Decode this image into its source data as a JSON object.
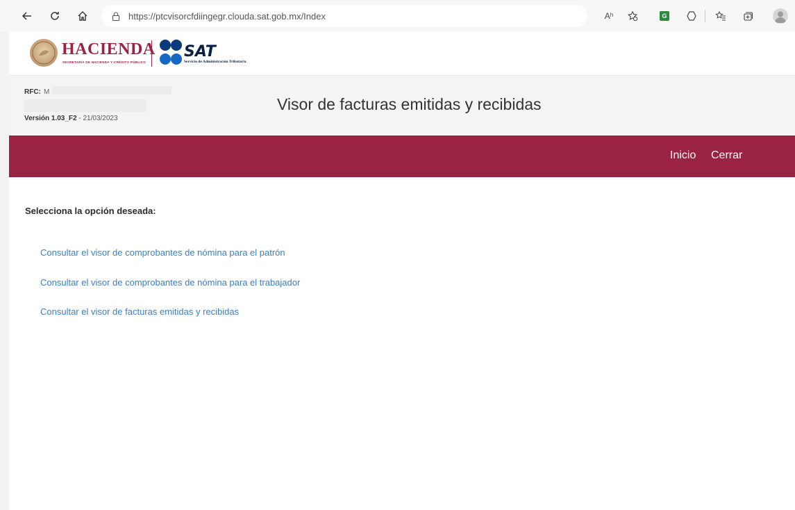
{
  "browser": {
    "url": "https://ptcvisorcfdiingegr.clouda.sat.gob.mx/Index",
    "icons": [
      "back-arrow-icon",
      "refresh-icon",
      "home-icon",
      "lock-icon",
      "read-aloud-icon",
      "favorite-add-icon",
      "extension-icon",
      "copilot-icon",
      "favorites-icon",
      "collections-icon",
      "profile-avatar-icon"
    ],
    "read_aloud_glyph": "Aʰ",
    "extension_glyph": "G"
  },
  "logos": {
    "hacienda": "HACIENDA",
    "hacienda_subtitle": "SECRETARÍA DE HACIENDA Y CRÉDITO PÚBLICO",
    "sat": "SAT",
    "sat_subtitle": "Servicio de Administración Tributaria"
  },
  "info": {
    "rfc_label": "RFC:",
    "rfc_value": "M",
    "version_label": "Versión 1.03_F2",
    "version_date": " - 21/03/2023",
    "page_title": "Visor de facturas emitidas y recibidas"
  },
  "nav": {
    "inicio": "Inicio",
    "cerrar": "Cerrar"
  },
  "main": {
    "prompt": "Selecciona la opción deseada:",
    "links": [
      "Consultar el visor de comprobantes de nómina para el patrón",
      "Consultar el visor de comprobantes de nómina para el trabajador",
      "Consultar el visor de facturas emitidas y recibidas"
    ]
  },
  "colors": {
    "brand_crimson": "#9a2343",
    "link_blue": "#3a81c4",
    "sat_navy": "#0a1f44"
  }
}
